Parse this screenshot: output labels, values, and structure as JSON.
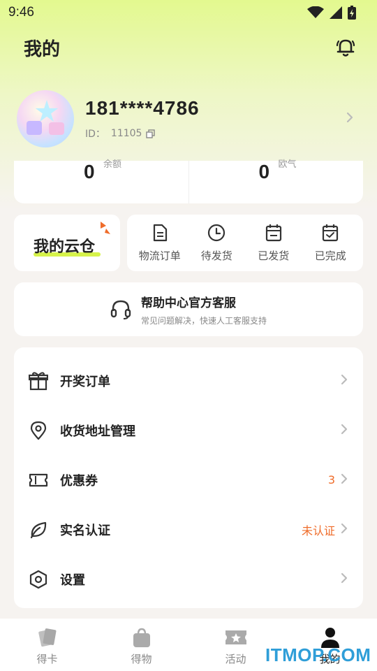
{
  "status_bar": {
    "time": "9:46"
  },
  "header": {
    "title": "我的"
  },
  "profile": {
    "phone": "181****4786",
    "id_label": "ID：",
    "id_value": "11105"
  },
  "stats": [
    {
      "value": "0",
      "label": "余额"
    },
    {
      "value": "0",
      "label": "欧气"
    }
  ],
  "warehouse": {
    "title": "我的云仓"
  },
  "orders": [
    {
      "label": "物流订单",
      "icon": "document-icon"
    },
    {
      "label": "待发货",
      "icon": "clock-icon"
    },
    {
      "label": "已发货",
      "icon": "calendar-icon"
    },
    {
      "label": "已完成",
      "icon": "calendar-check-icon"
    }
  ],
  "help": {
    "title": "帮助中心官方客服",
    "subtitle": "常见问题解决，快速人工客服支持"
  },
  "menu": [
    {
      "label": "开奖订单",
      "icon": "gift-icon",
      "extra": ""
    },
    {
      "label": "收货地址管理",
      "icon": "location-pin-icon",
      "extra": ""
    },
    {
      "label": "优惠券",
      "icon": "ticket-icon",
      "extra": "3"
    },
    {
      "label": "实名认证",
      "icon": "leaf-icon",
      "extra": "未认证"
    },
    {
      "label": "设置",
      "icon": "settings-hexagon-icon",
      "extra": ""
    }
  ],
  "bottom_nav": [
    {
      "label": "得卡",
      "icon": "cards-icon"
    },
    {
      "label": "得物",
      "icon": "bag-icon"
    },
    {
      "label": "活动",
      "icon": "star-ticket-icon"
    },
    {
      "label": "我的",
      "icon": "person-icon"
    }
  ],
  "watermark": "ITMOP.COM",
  "colors": {
    "accent_orange": "#ef6c2a",
    "highlight_green": "#d6f34a",
    "gradient_top": "#e3f98f"
  }
}
